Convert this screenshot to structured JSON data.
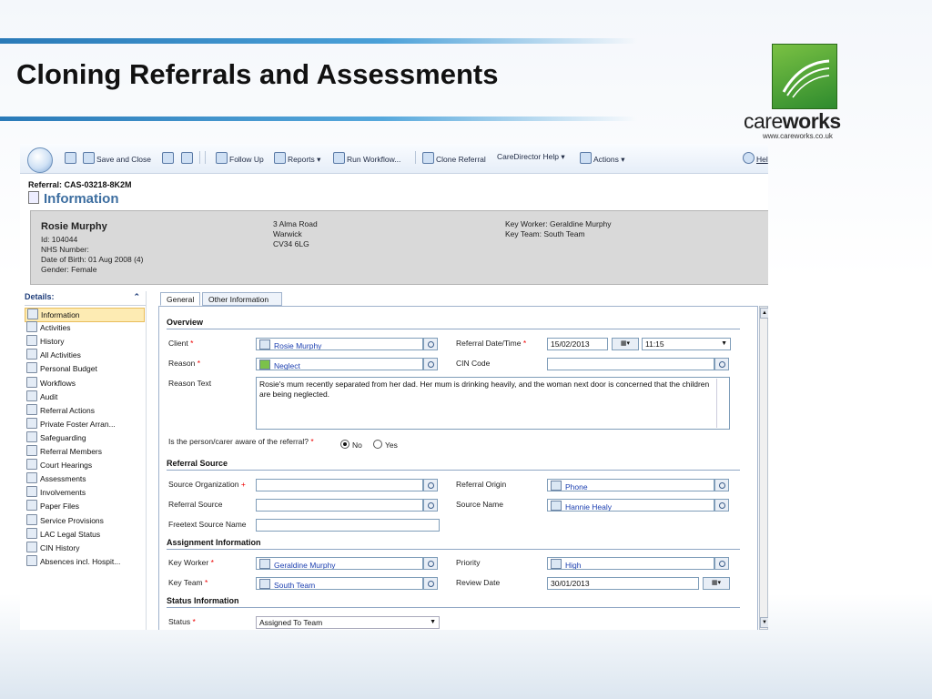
{
  "slide": {
    "title": "Cloning Referrals and Assessments",
    "logo_care": "care",
    "logo_works": "works",
    "logo_url": "www.careworks.co.uk"
  },
  "toolbar": {
    "save_and_close": "Save and Close",
    "follow_up": "Follow Up",
    "reports": "Reports ▾",
    "run_workflow": "Run Workflow...",
    "clone_referral": "Clone Referral",
    "caredirector_help": "CareDirector Help ▾",
    "actions": "Actions ▾",
    "help": "Hel"
  },
  "record": {
    "referral_title": "Referral: CAS-03218-8K2M",
    "section_title": "Information"
  },
  "client": {
    "name": "Rosie Murphy",
    "id": "Id: 104044",
    "nhs": "NHS Number:",
    "dob": "Date of Birth: 01 Aug 2008 (4)",
    "gender": "Gender: Female",
    "address1": "3 Alma Road",
    "address2": "Warwick",
    "address3": "CV34 6LG",
    "key_worker": "Key Worker: Geraldine Murphy",
    "key_team": "Key Team: South Team"
  },
  "nav": {
    "header": "Details:",
    "items": [
      {
        "label": "Information",
        "icon": "information-icon"
      },
      {
        "label": "Activities",
        "icon": "activities-icon"
      },
      {
        "label": "History",
        "icon": "history-icon"
      },
      {
        "label": "All Activities",
        "icon": "all-activities-icon"
      },
      {
        "label": "Personal Budget",
        "icon": "personal-budget-icon"
      },
      {
        "label": "Workflows",
        "icon": "workflows-icon"
      },
      {
        "label": "Audit",
        "icon": "audit-icon"
      },
      {
        "label": "Referral Actions",
        "icon": "referral-actions-icon"
      },
      {
        "label": "Private Foster Arran...",
        "icon": "private-foster-icon"
      },
      {
        "label": "Safeguarding",
        "icon": "safeguarding-icon"
      },
      {
        "label": "Referral Members",
        "icon": "referral-members-icon"
      },
      {
        "label": "Court Hearings",
        "icon": "court-hearings-icon"
      },
      {
        "label": "Assessments",
        "icon": "assessments-icon"
      },
      {
        "label": "Involvements",
        "icon": "involvements-icon"
      },
      {
        "label": "Paper Files",
        "icon": "paper-files-icon"
      },
      {
        "label": "Service Provisions",
        "icon": "service-provisions-icon"
      },
      {
        "label": "LAC Legal Status",
        "icon": "lac-legal-status-icon"
      },
      {
        "label": "CIN History",
        "icon": "cin-history-icon"
      },
      {
        "label": "Absences incl. Hospit...",
        "icon": "absences-icon"
      }
    ]
  },
  "tabs": {
    "general": "General",
    "other": "Other Information"
  },
  "form": {
    "overview": "Overview",
    "client_label": "Client",
    "client_value": "Rosie Murphy",
    "referral_datetime_label": "Referral Date/Time",
    "referral_date": "15/02/2013",
    "referral_time": "11:15",
    "reason_label": "Reason",
    "reason_value": "Neglect",
    "cin_code_label": "CIN Code",
    "reason_text_label": "Reason Text",
    "reason_text_value": "Rosie's mum recently separated from her dad. Her mum is drinking heavily, and the woman next door is concerned that the children are being neglected.",
    "aware_label": "Is the person/carer aware of the referral?",
    "aware_no": "No",
    "aware_yes": "Yes",
    "referral_source_section": "Referral Source",
    "source_org_label": "Source Organization",
    "referral_origin_label": "Referral Origin",
    "referral_origin_value": "Phone",
    "referral_source_label": "Referral Source",
    "source_name_label": "Source Name",
    "source_name_value": "Hannie Healy",
    "freetext_source_label": "Freetext Source Name",
    "assignment_section": "Assignment Information",
    "key_worker_label": "Key Worker",
    "key_worker_value": "Geraldine Murphy",
    "priority_label": "Priority",
    "priority_value": "High",
    "key_team_label": "Key Team",
    "key_team_value": "South Team",
    "review_date_label": "Review Date",
    "review_date_value": "30/01/2013",
    "status_section": "Status Information",
    "status_label": "Status",
    "status_value": "Assigned To Team",
    "required_mark": "*",
    "recommended_mark": "+"
  }
}
